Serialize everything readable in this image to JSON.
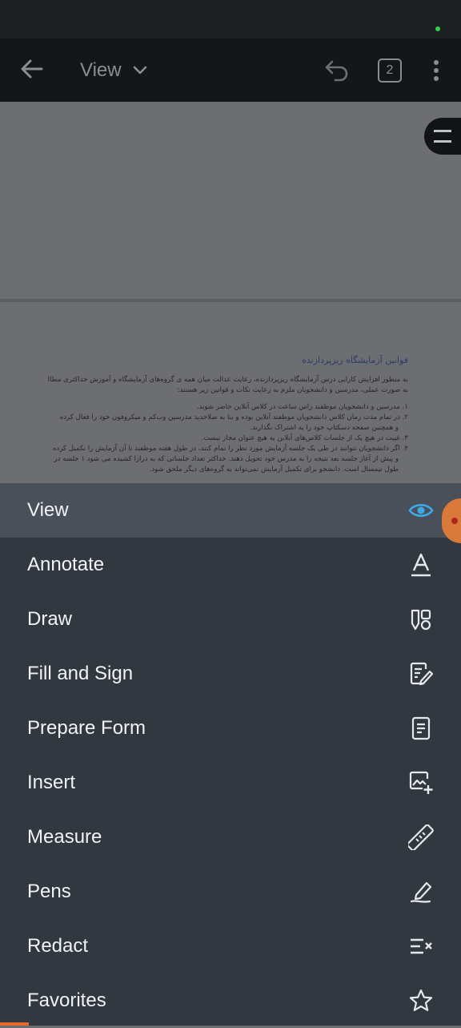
{
  "toolbar": {
    "mode_label": "View",
    "page_count": "2"
  },
  "document": {
    "title": "قوانین آزمایشگاه ریزپردازنده",
    "intro_lines": [
      "به منظور افزایش کارایی درس آزمایشگاه ریزپردازنده، رعایت عدالت میان همه ی گروه‌های آزمایشگاه و آموزش حداکثری مطالب درس",
      "به صورت عملی، مدرسین و دانشجویان ملزم به رعایت نکات و قوانین زیر هستند:"
    ],
    "rule_lines": [
      "۱.   مدرسین و دانشجویان موظفند راس ساعت در کلاس آنلاین حاضر شوند.",
      "۲.   در تمام مدت زمان کلاس دانشجویان موظفند آنلاین بوده و بنا به صلاحدید مدرسین وب‌کم و میکروفون خود را فعال کرده",
      "و همچنین صفحه دسکتاپ خود را به اشتراک بگذارند.",
      "۳.   غیبت در هیچ یک از جلسات کلاس‌های آنلاین به هیچ عنوان مجاز نیست.",
      "۴.   اگر دانشجویان نتوانند در طی یک جلسه آزمایش مورد نظر را تمام کنند، در طول هفته موظفند تا آن آزمایش را تکمیل کرده",
      "و پیش از آغاز جلسه بعد نتیجه را به مدرس خود تحویل دهند. حداکثر تعداد جلساتی که به درازا کشیده می شود ۱ جلسه در",
      "طول نیمسال است. دانشجو برای تکمیل آزمایش نمی‌تواند به گروه‌های دیگر ملحق شود."
    ]
  },
  "menu": {
    "items": [
      {
        "label": "View",
        "icon": "eye-icon",
        "selected": true
      },
      {
        "label": "Annotate",
        "icon": "text-annotate-icon"
      },
      {
        "label": "Draw",
        "icon": "draw-shapes-icon"
      },
      {
        "label": "Fill and Sign",
        "icon": "fill-sign-icon"
      },
      {
        "label": "Prepare Form",
        "icon": "form-icon"
      },
      {
        "label": "Insert",
        "icon": "insert-image-icon"
      },
      {
        "label": "Measure",
        "icon": "ruler-icon"
      },
      {
        "label": "Pens",
        "icon": "pen-icon"
      },
      {
        "label": "Redact",
        "icon": "redact-icon"
      },
      {
        "label": "Favorites",
        "icon": "star-icon"
      }
    ]
  },
  "colors": {
    "accent_blue": "#3da9e6",
    "menu_bg": "#323840",
    "menu_selected": "#49505a",
    "toolbar_bg": "#141618",
    "knob_orange": "#d97a3a"
  }
}
